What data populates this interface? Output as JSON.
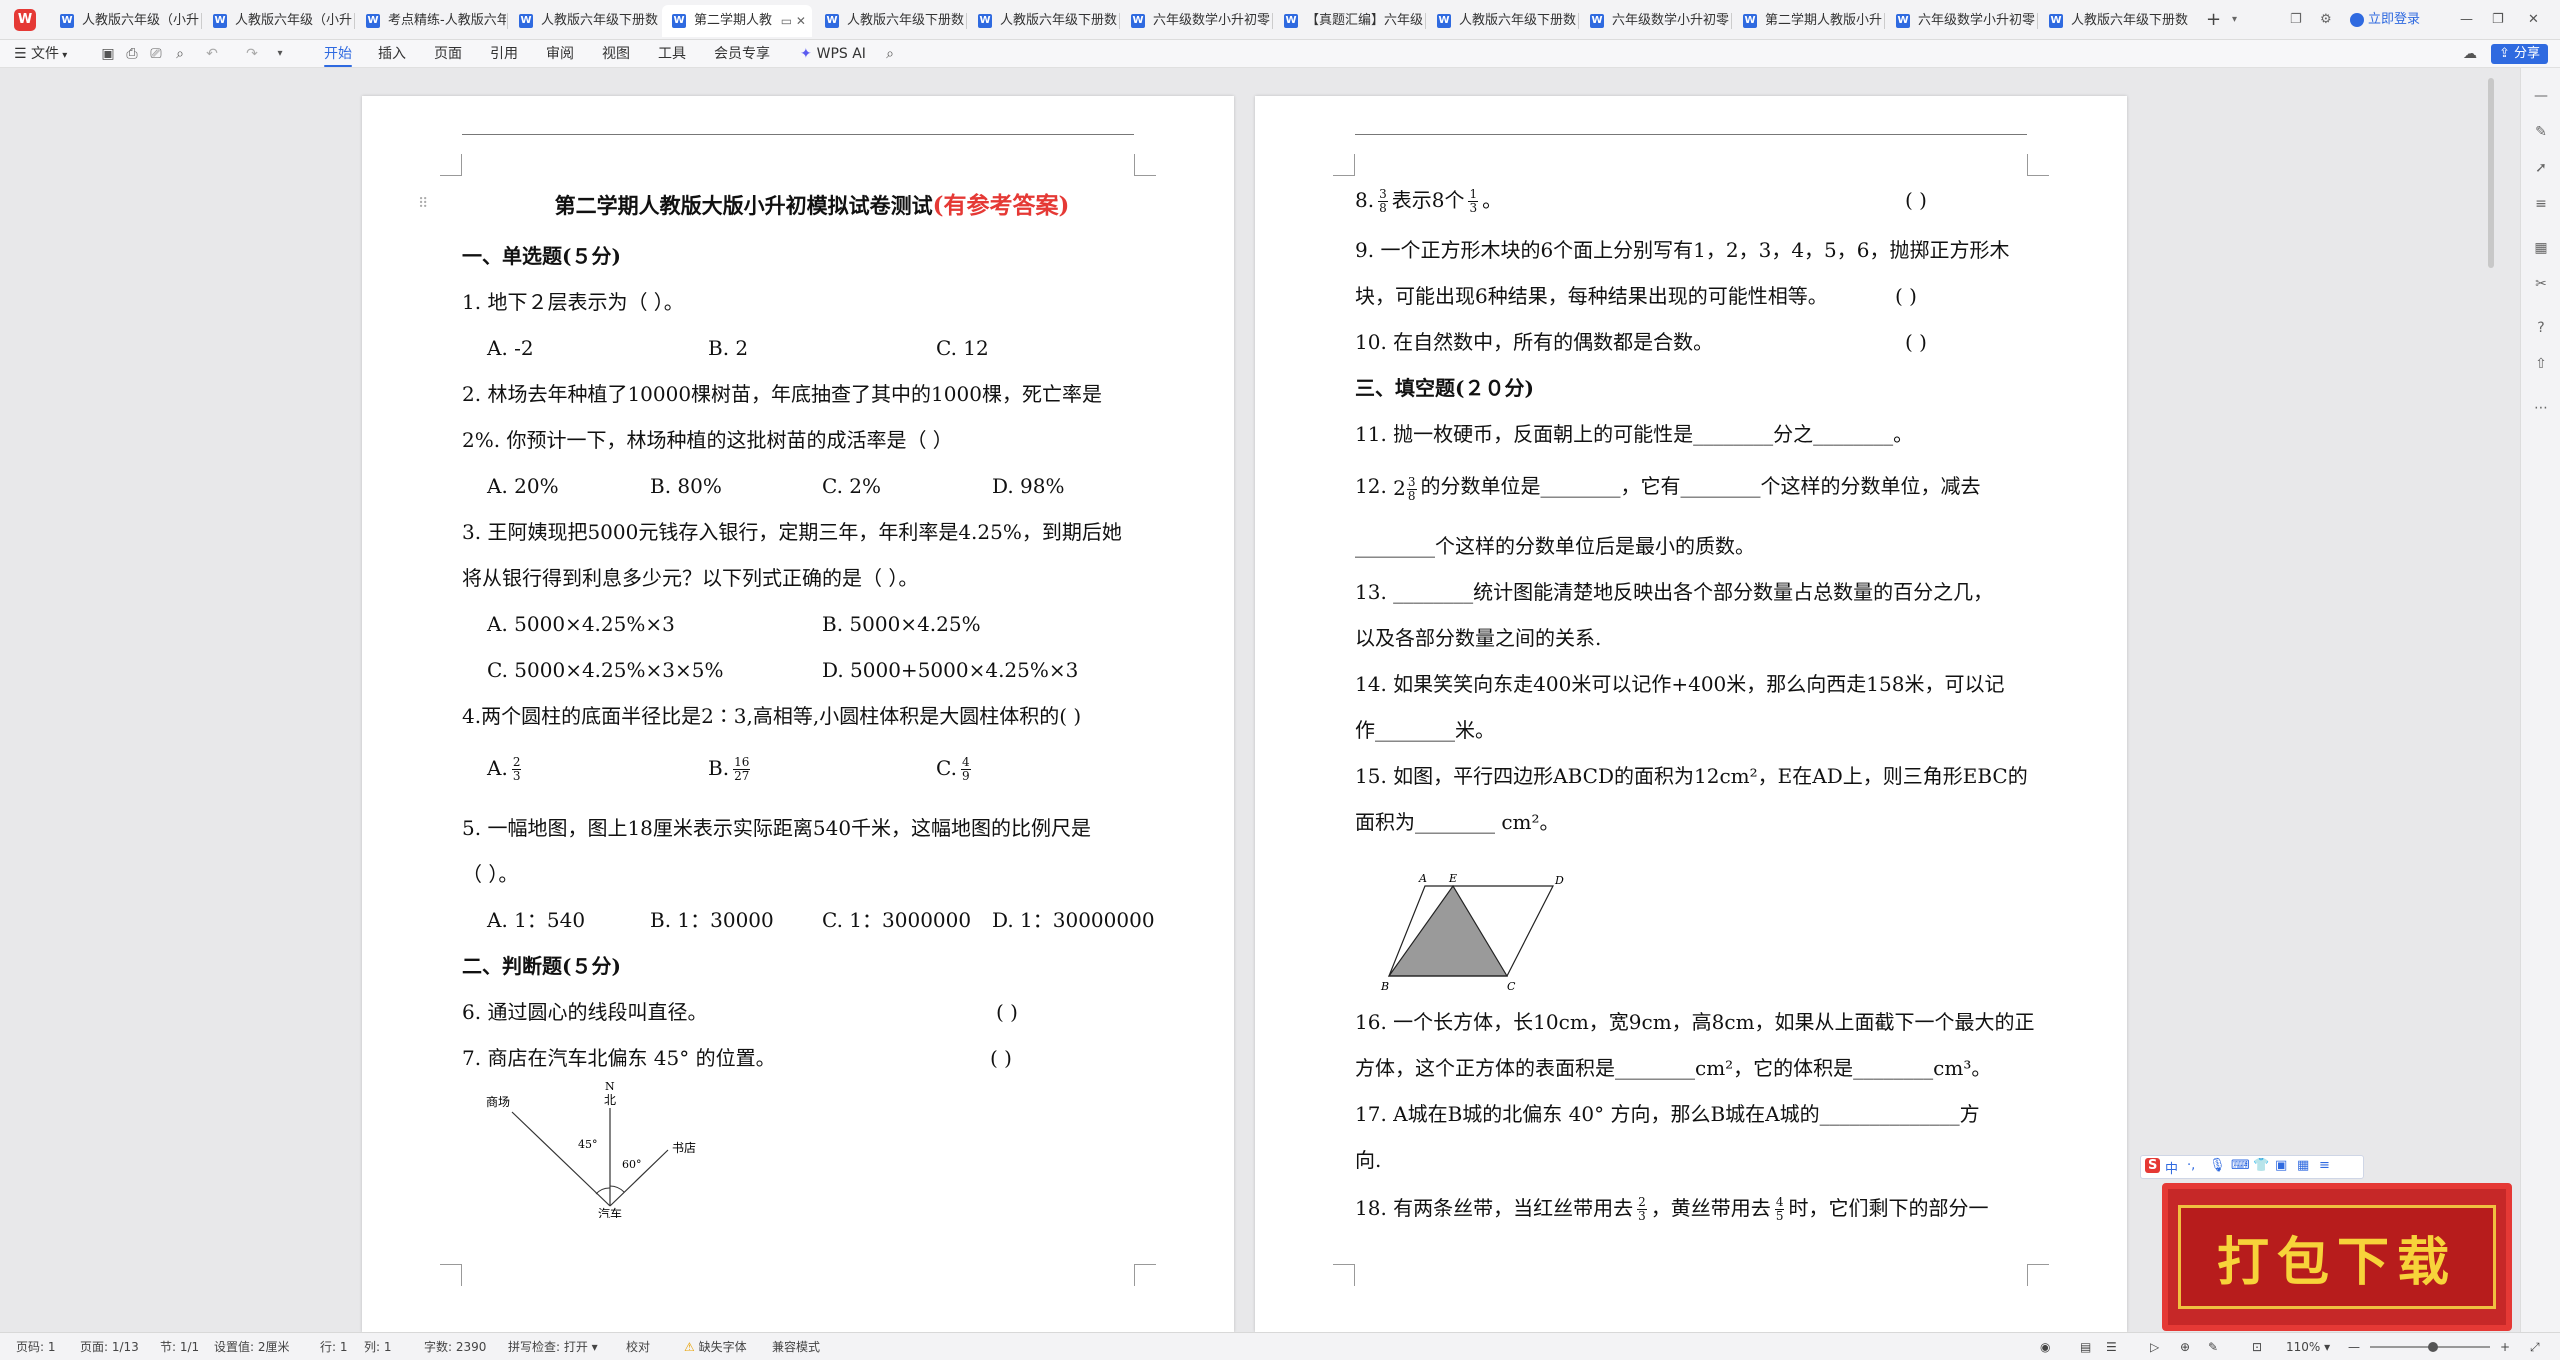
{
  "tabs": [
    {
      "label": "人教版六年级（小升"
    },
    {
      "label": "人教版六年级（小升"
    },
    {
      "label": "考点精练-人教版六年"
    },
    {
      "label": "人教版六年级下册数"
    },
    {
      "label": "第二学期人教"
    },
    {
      "label": "人教版六年级下册数"
    },
    {
      "label": "人教版六年级下册数"
    },
    {
      "label": "六年级数学小升初零"
    },
    {
      "label": "【真题汇编】六年级"
    },
    {
      "label": "人教版六年级下册数"
    },
    {
      "label": "六年级数学小升初零"
    },
    {
      "label": "第二学期人教版小升"
    },
    {
      "label": "六年级数学小升初零"
    },
    {
      "label": "人教版六年级下册数"
    }
  ],
  "tabbar": {
    "new_tab": "+",
    "login": "立即登录"
  },
  "menu": {
    "file": "文件",
    "items": [
      "开始",
      "插入",
      "页面",
      "引用",
      "审阅",
      "视图",
      "工具",
      "会员专享"
    ],
    "wps_ai": "WPS AI",
    "share": "分享"
  },
  "page1": {
    "title": "第二学期人教版大版小升初模拟试卷测试",
    "title_red": "(有参考答案)",
    "sec1": "一、单选题(５分)",
    "q1": "1. 地下２层表示为（     ）。",
    "q1_opts": [
      "A. -2",
      "B. 2",
      "C. 12"
    ],
    "q2a": "2. 林场去年种植了10000棵树苗，年底抽查了其中的1000棵，死亡率是",
    "q2b": "2%. 你预计一下，林场种植的这批树苗的成活率是（     ）",
    "q2_opts": [
      "A. 20%",
      "B. 80%",
      "C. 2%",
      "D. 98%"
    ],
    "q3a": "3. 王阿姨现把5000元钱存入银行，定期三年，年利率是4.25%，到期后她",
    "q3b": "将从银行得到利息多少元？以下列式正确的是（     ）。",
    "q3_opts": [
      "A. 5000×4.25%×3",
      "B. 5000×4.25%",
      "C. 5000×4.25%×3×5%",
      "D. 5000+5000×4.25%×3"
    ],
    "q4": "4.两个圆柱的底面半径比是2∶3,高相等,小圆柱体积是大圆柱体积的(      )",
    "q4_opts": [
      {
        "label": "A.",
        "n": "2",
        "d": "3"
      },
      {
        "label": "B.",
        "n": "16",
        "d": "27"
      },
      {
        "label": "C.",
        "n": "4",
        "d": "9"
      }
    ],
    "q5a": "5. 一幅地图，图上18厘米表示实际距离540千米，这幅地图的比例尺是",
    "q5b": "（     ）。",
    "q5_opts": [
      "A. 1：540",
      "B. 1：30000",
      "C. 1：3000000",
      "D. 1：30000000"
    ],
    "sec2": "二、判断题(５分)",
    "q6": "6. 通过圆心的线段叫直径。",
    "q6_paren": "(     )",
    "q7": "7. 商店在汽车北偏东 45° 的位置。",
    "q7_paren": "(     )",
    "fig7": {
      "n": "N",
      "north": "北",
      "mall": "商场",
      "bookstore": "书店",
      "car": "汽车",
      "a1": "45°",
      "a2": "60°"
    }
  },
  "page2": {
    "q8_prefix": "8.",
    "q8_f1": {
      "n": "3",
      "d": "8"
    },
    "q8_mid": "表示8个",
    "q8_f2": {
      "n": "1",
      "d": "3"
    },
    "q8_end": "。",
    "q8_paren": "(     )",
    "q9a": "9. 一个正方形木块的6个面上分别写有1，2，3，4，5，6，抛掷正方形木",
    "q9b": "块，可能出现6种结果，每种结果出现的可能性相等。",
    "q9_paren": "(     )",
    "q10": "10. 在自然数中，所有的偶数都是合数。",
    "q10_paren": "(     )",
    "sec3": "三、填空题(２０分)",
    "q11": "11. 抛一枚硬币，反面朝上的可能性是________分之________。",
    "q12_prefix": "12.",
    "q12_whole": "2",
    "q12_f": {
      "n": "3",
      "d": "8"
    },
    "q12_rest": "的分数单位是________，它有________个这样的分数单位，减去",
    "q12b": "________个这样的分数单位后是最小的质数。",
    "q13a": "13. ________统计图能清楚地反映出各个部分数量占总数量的百分之几，",
    "q13b": "以及各部分数量之间的关系.",
    "q14a": "14. 如果笑笑向东走400米可以记作+400米，那么向西走158米，可以记",
    "q14b": "作________米。",
    "q15a": "15. 如图，平行四边形ABCD的面积为12cm²，E在AD上，则三角形EBC的",
    "q15b": "面积为________ cm²。",
    "fig15": {
      "a": "A",
      "e": "E",
      "d": "D",
      "b": "B",
      "c": "C"
    },
    "q16a": "16. 一个长方体，长10cm，宽9cm，高8cm，如果从上面截下一个最大的正",
    "q16b": "方体，这个正方体的表面积是________cm²，它的体积是________cm³。",
    "q17a": "17. A城在B城的北偏东 40° 方向，那么B城在A城的______________方",
    "q17b": "向.",
    "q18_prefix": "18. 有两条丝带，当红丝带用去",
    "q18_f1": {
      "n": "2",
      "d": "3"
    },
    "q18_mid": "，黄丝带用去",
    "q18_f2": {
      "n": "4",
      "d": "5"
    },
    "q18_end": "时，它们剩下的部分一"
  },
  "ime": {
    "s": "S",
    "zh": "中"
  },
  "banner": {
    "text": "打包下载"
  },
  "status": {
    "page_num": "页码: 1",
    "pages": "页面: 1/13",
    "section": "节: 1/1",
    "setting": "设置值: 2厘米",
    "row": "行: 1",
    "col": "列: 1",
    "words": "字数: 2390",
    "spell": "拼写检查: 打开",
    "proof": "校对",
    "missing_font": "缺失字体",
    "compat": "兼容模式",
    "zoom": "110%"
  },
  "colors": {
    "accent": "#2f6ae0",
    "title_red": "#e53935",
    "banner_red": "#c62828",
    "banner_text": "#f7d33a"
  }
}
